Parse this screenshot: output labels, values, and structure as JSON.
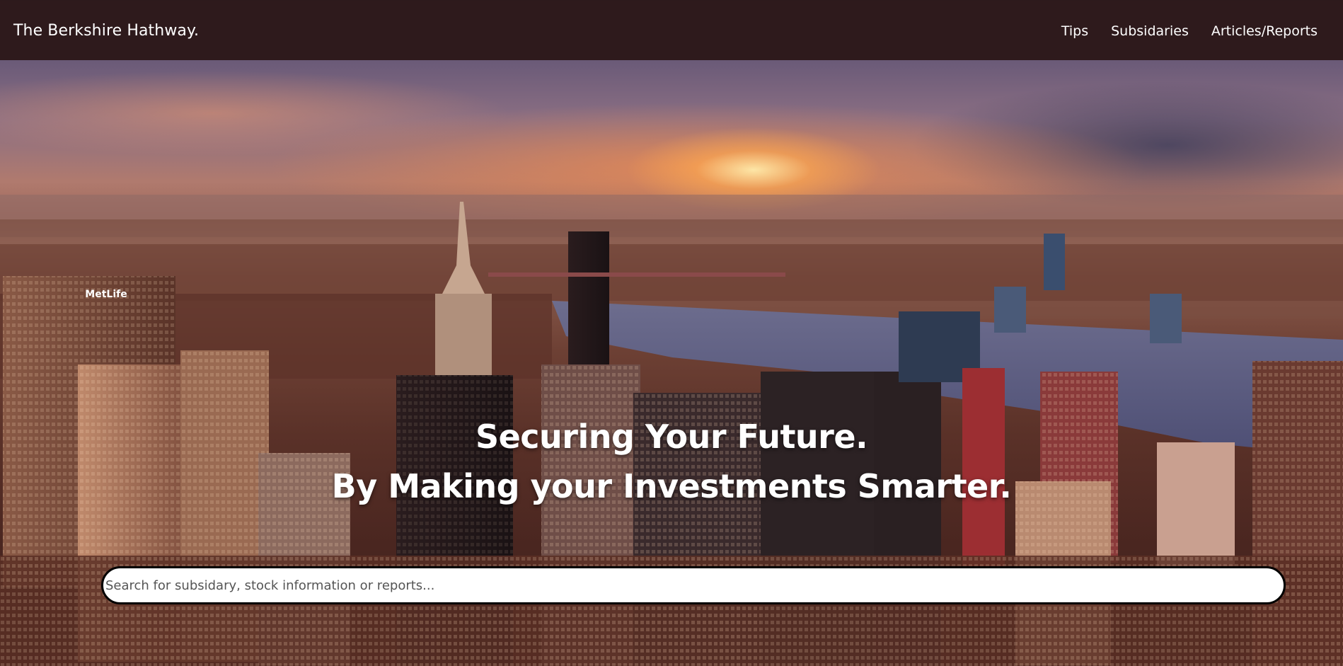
{
  "header": {
    "brand": "The Berkshire Hathway.",
    "nav": [
      {
        "label": "Tips"
      },
      {
        "label": "Subsidaries"
      },
      {
        "label": "Articles/Reports"
      }
    ]
  },
  "hero": {
    "headline_line1": "Securing Your Future.",
    "headline_line2": "By Making your Investments Smarter.",
    "search": {
      "placeholder": "Search for subsidary, stock information or reports...",
      "value": ""
    },
    "building_sign": "MetLife"
  },
  "colors": {
    "topbar": "#2e1a1c",
    "text": "#ffffff",
    "search_border": "#000000"
  }
}
